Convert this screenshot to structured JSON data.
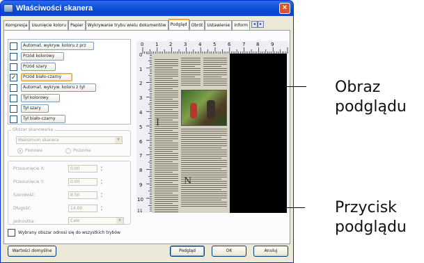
{
  "window": {
    "title": "Właściwości skanera",
    "close_label": "×"
  },
  "tabs": [
    {
      "label": "Kompresja",
      "active": false
    },
    {
      "label": "Usunięcie koloru",
      "active": false
    },
    {
      "label": "Papier",
      "active": false
    },
    {
      "label": "Wykrywanie trybu wielu dokumentów",
      "active": false
    },
    {
      "label": "Podgląd",
      "active": true
    },
    {
      "label": "Obrót",
      "active": false
    },
    {
      "label": "Ustawienie",
      "active": false
    },
    {
      "label": "Inform",
      "active": false
    }
  ],
  "tab_scroll": {
    "left": "◂",
    "right": "▸"
  },
  "image_list": [
    {
      "label": "Automat. wykryw. koloru z prz",
      "checked": false
    },
    {
      "label": "Przód kolorowy",
      "checked": false
    },
    {
      "label": "Przód szary",
      "checked": false
    },
    {
      "label": "Przód biało-czarny",
      "checked": true
    },
    {
      "label": "Automat. wykryw. koloru z tył",
      "checked": false
    },
    {
      "label": "Tył kolorowy",
      "checked": false
    },
    {
      "label": "Tył szary",
      "checked": false
    },
    {
      "label": "Tył biało-czarny",
      "checked": false
    }
  ],
  "scan_area": {
    "label": "Obszar skanowania",
    "value": "Maksimum skanera",
    "orientation_portrait": "Pionowa",
    "orientation_landscape": "Pozioma"
  },
  "offsets": {
    "offset_x_label": "Przesunięcie X:",
    "offset_x_value": "0.00",
    "offset_y_label": "Przesunięcie Y:",
    "offset_y_value": "0.00",
    "width_label": "Szerokość:",
    "width_value": "8.50",
    "length_label": "Długość:",
    "length_value": "14.00",
    "unit_label": "Jednostka:",
    "unit_value": "Cale"
  },
  "apply_all_label": "Wybrany obszar odnosi się do wszystkich trybów",
  "buttons": {
    "defaults": "Wartości domyślne",
    "preview": "Podgląd",
    "ok": "OK",
    "cancel": "Anuluj"
  },
  "ruler": {
    "top": [
      "0",
      "1",
      "2",
      "3",
      "4",
      "5",
      "6",
      "7",
      "8",
      "9"
    ],
    "left": [
      "0",
      "1",
      "2",
      "3",
      "4",
      "5",
      "6",
      "7",
      "8",
      "9",
      "10",
      "11"
    ]
  },
  "callouts": {
    "preview_image": [
      "Obraz",
      "podglądu"
    ],
    "preview_button": [
      "Przycisk",
      "podglądu"
    ]
  },
  "colors": {
    "title_bar": "#0a4bd6",
    "dialog_bg": "#ece9d8",
    "tab_active_accent": "#f5a623",
    "selection_highlight": "#e8a43a"
  }
}
